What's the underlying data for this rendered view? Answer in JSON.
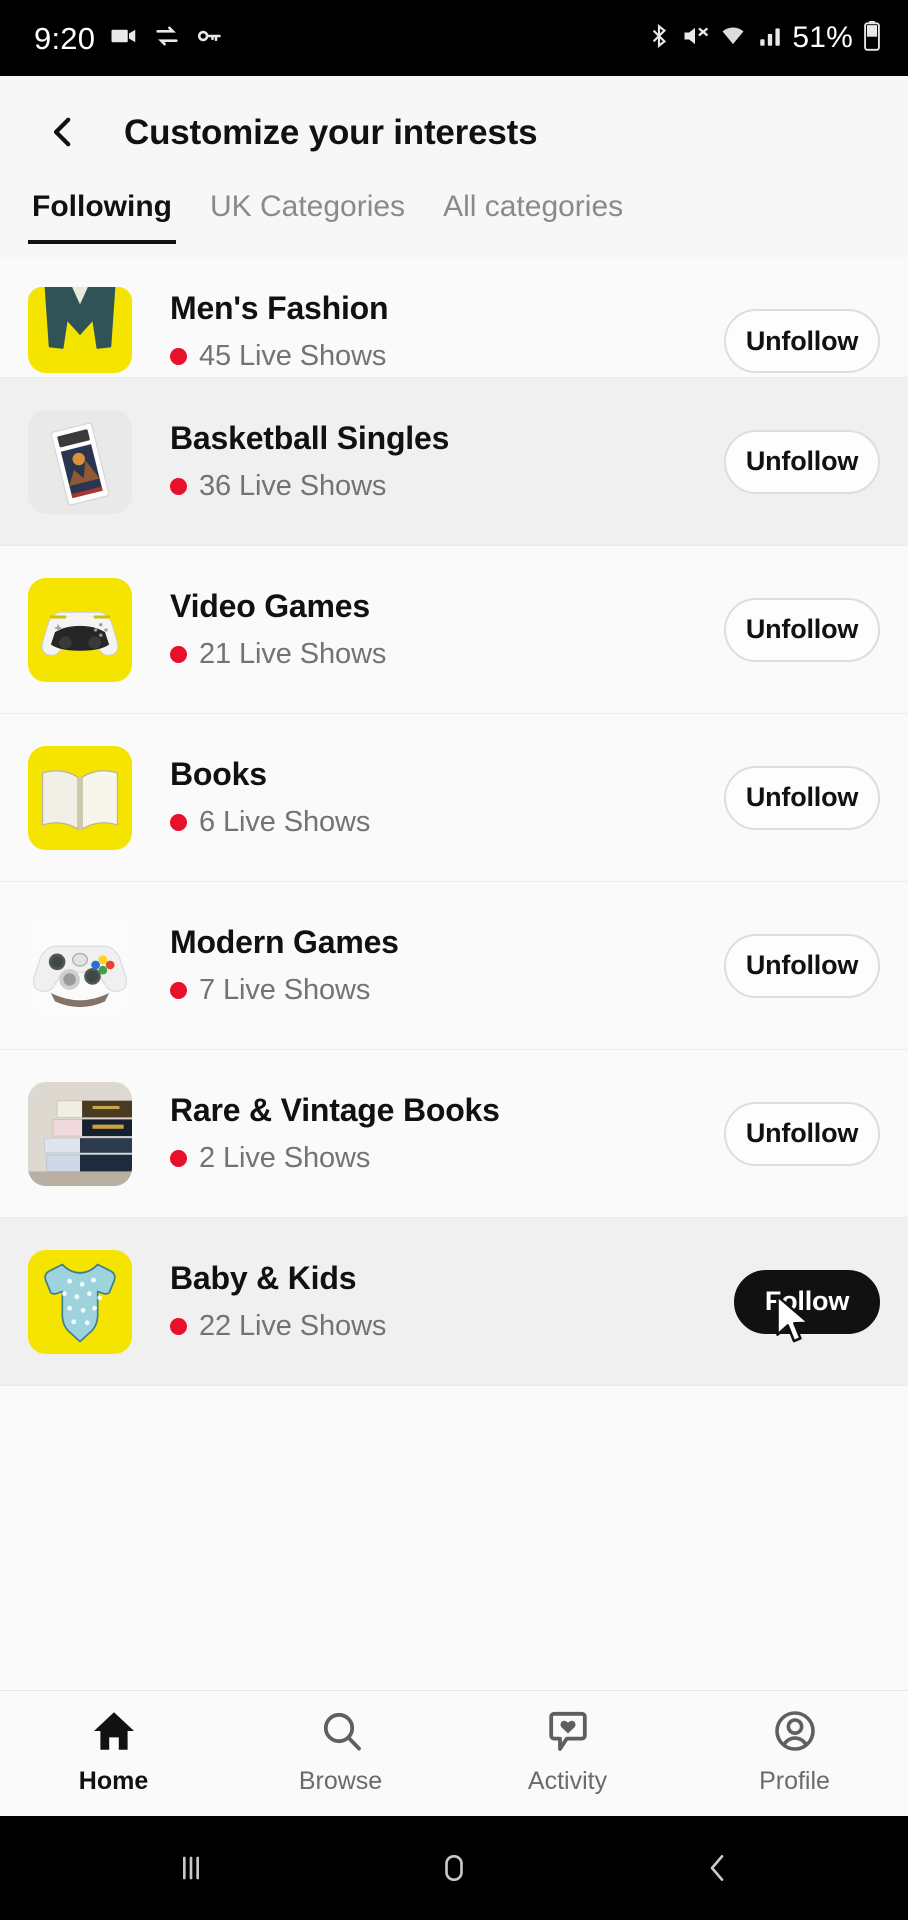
{
  "status_bar": {
    "time": "9:20",
    "left_icons": [
      "video-camera-icon",
      "data-saver-icon",
      "vpn-key-icon"
    ],
    "right_icons": [
      "bluetooth-icon",
      "mute-icon",
      "wifi-icon",
      "cellular-signal-icon"
    ],
    "battery_percent": "51%"
  },
  "header": {
    "back_icon": "chevron-left-icon",
    "title": "Customize your interests"
  },
  "tabs": [
    {
      "label": "Following",
      "active": true
    },
    {
      "label": "UK Categories",
      "active": false
    },
    {
      "label": "All categories",
      "active": false
    }
  ],
  "list": {
    "rows": [
      {
        "title": "Men's Fashion",
        "live": "45 Live Shows",
        "button": "Unfollow",
        "button_style": "outline",
        "thumb": "mens-jacket-thumbnail",
        "thumb_bg": "#F5E400",
        "highlight": false,
        "partial": true
      },
      {
        "title": "Basketball Singles",
        "live": "36 Live Shows",
        "button": "Unfollow",
        "button_style": "outline",
        "thumb": "graded-card-slab-thumbnail",
        "thumb_bg": "#e9e9e9",
        "highlight": true,
        "partial": false
      },
      {
        "title": "Video Games",
        "live": "21 Live Shows",
        "button": "Unfollow",
        "button_style": "outline",
        "thumb": "playstation-controller-thumbnail",
        "thumb_bg": "#F5E400",
        "highlight": false,
        "partial": false
      },
      {
        "title": "Books",
        "live": "6 Live Shows",
        "button": "Unfollow",
        "button_style": "outline",
        "thumb": "open-book-thumbnail",
        "thumb_bg": "#F5E400",
        "highlight": false,
        "partial": false
      },
      {
        "title": "Modern Games",
        "live": "7 Live Shows",
        "button": "Unfollow",
        "button_style": "outline",
        "thumb": "xbox-controller-thumbnail",
        "thumb_bg": "#ffffff",
        "highlight": false,
        "partial": false
      },
      {
        "title": "Rare & Vintage Books",
        "live": "2 Live Shows",
        "button": "Unfollow",
        "button_style": "outline",
        "thumb": "book-stack-thumbnail",
        "thumb_bg": "#d8d3cc",
        "highlight": false,
        "partial": false
      },
      {
        "title": "Baby & Kids",
        "live": "22 Live Shows",
        "button": "Follow",
        "button_style": "dark",
        "thumb": "baby-onesie-thumbnail",
        "thumb_bg": "#F5E400",
        "highlight": true,
        "partial": false
      }
    ]
  },
  "bottom_nav": [
    {
      "label": "Home",
      "icon": "home-icon",
      "active": true
    },
    {
      "label": "Browse",
      "icon": "search-icon",
      "active": false
    },
    {
      "label": "Activity",
      "icon": "activity-heart-bubble-icon",
      "active": false
    },
    {
      "label": "Profile",
      "icon": "profile-icon",
      "active": false
    }
  ],
  "system_nav": [
    {
      "icon": "recents-icon"
    },
    {
      "icon": "home-square-icon"
    },
    {
      "icon": "back-chevron-icon"
    }
  ],
  "colors": {
    "brand_yellow": "#F5E400",
    "live_red": "#E8102A",
    "text_primary": "#111111",
    "text_secondary": "#737373",
    "page_bg": "#fafafa"
  }
}
